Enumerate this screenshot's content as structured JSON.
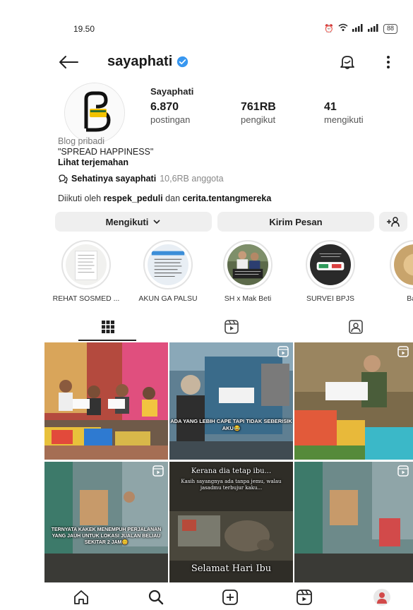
{
  "status": {
    "time": "19.50",
    "battery": "88"
  },
  "header": {
    "username": "sayaphati"
  },
  "profile": {
    "display_name": "Sayaphati",
    "stats": [
      {
        "value": "6.870",
        "label": "postingan"
      },
      {
        "value": "761RB",
        "label": "pengikut"
      },
      {
        "value": "41",
        "label": "mengikuti"
      }
    ],
    "category": "Blog pribadi",
    "bio": "\"SPREAD HAPPINESS\"",
    "translate": "Lihat terjemahan",
    "community_name": "Sehatinya sayaphati",
    "community_count": "10,6RB anggota",
    "followed_prefix": "Diikuti oleh ",
    "followed_user1": "respek_peduli",
    "followed_and": " dan ",
    "followed_user2": "cerita.tentangmereka"
  },
  "actions": {
    "following": "Mengikuti",
    "message": "Kirim Pesan"
  },
  "highlights": [
    {
      "label": "REHAT SOSMED ..."
    },
    {
      "label": "AKUN GA PALSU"
    },
    {
      "label": "SH x Mak Beti"
    },
    {
      "label": "SURVEI BPJS"
    },
    {
      "label": "Ba..."
    }
  ],
  "posts": [
    {
      "caption": ""
    },
    {
      "caption": "ADA YANG LEBIH CAPE TAPI TIDAK SEBERISIK AKU😂"
    },
    {
      "caption": ""
    },
    {
      "caption": "TERNYATA KAKEK MENEMPUH PERJALANAN YANG JAUH UNTUK LOKASI JUALAN BELIAU SEKITAR 2 JAM😊"
    },
    {
      "caption_top": "Kerana dia tetap ibu...",
      "caption_mid": "Kasih sayangnya ada tanpa jemu, walau jasadmu terbujur kaku...",
      "caption_bottom": "Selamat Hari Ibu"
    },
    {
      "caption": ""
    }
  ]
}
